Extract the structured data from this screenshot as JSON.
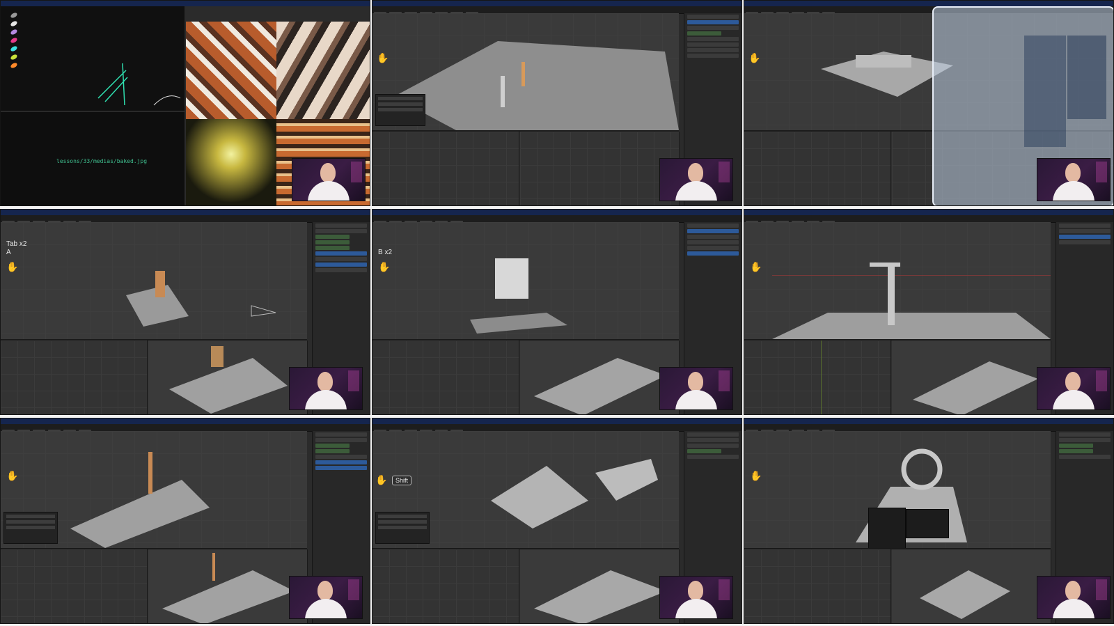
{
  "tiles": [
    {
      "id": "tile-1",
      "kind": "editor-and-textures",
      "file_path": "lessons/33/medias/baked.jpg"
    },
    {
      "id": "tile-2",
      "kind": "blender"
    },
    {
      "id": "tile-3",
      "kind": "blender-dialog"
    },
    {
      "id": "tile-4",
      "kind": "blender",
      "key_hint_1": "Tab x2",
      "key_hint_2": "A"
    },
    {
      "id": "tile-5",
      "kind": "blender",
      "key_hint_1": "B x2"
    },
    {
      "id": "tile-6",
      "kind": "blender"
    },
    {
      "id": "tile-7",
      "kind": "blender"
    },
    {
      "id": "tile-8",
      "kind": "blender",
      "key_badge": "Shift"
    },
    {
      "id": "tile-9",
      "kind": "blender-menu"
    }
  ],
  "colors": {
    "topbar": "#15254e",
    "viewport": "#3a3a3a",
    "selection": "#2d5a9a",
    "accent_orange": "#e88a2e"
  },
  "icons": {
    "nav_gizmo": "hand-icon",
    "palette_dots": [
      "color-dot-icon"
    ]
  }
}
